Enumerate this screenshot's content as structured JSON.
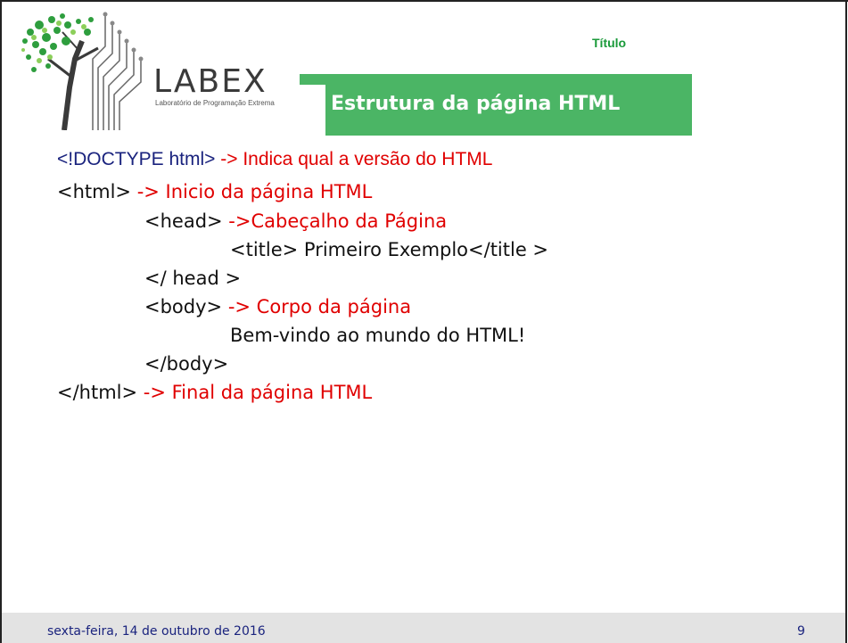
{
  "header": {
    "small_title": "Título",
    "slide_title": "Estrutura da página HTML"
  },
  "logo": {
    "word": "LABEX",
    "subtitle": "Laboratório de Programação Extrema"
  },
  "doctype": {
    "code": "<!DOCTYPE html>",
    "note": " -> Indica  qual a versão do HTML"
  },
  "code_lines": [
    {
      "code": "<html> ",
      "note": "-> Inicio da página HTML"
    },
    {
      "code": "<head> ",
      "note": "->Cabeçalho da Página"
    },
    {
      "code": "<title> Primeiro Exemplo</title >",
      "note": ""
    },
    {
      "code": "</ head >",
      "note": ""
    },
    {
      "code": "<body> ",
      "note": "-> Corpo da página"
    },
    {
      "code": "Bem-vindo ao mundo do HTML!",
      "note": ""
    },
    {
      "code": "</body>",
      "note": ""
    },
    {
      "code": "</html> ",
      "note": "-> Final da página HTML"
    }
  ],
  "footer": {
    "date": "sexta-feira, 14 de outubro de 2016",
    "page": "9"
  },
  "colors": {
    "accent_green": "#4bb565",
    "note_red": "#e00000",
    "code_navy": "#1a237e"
  }
}
